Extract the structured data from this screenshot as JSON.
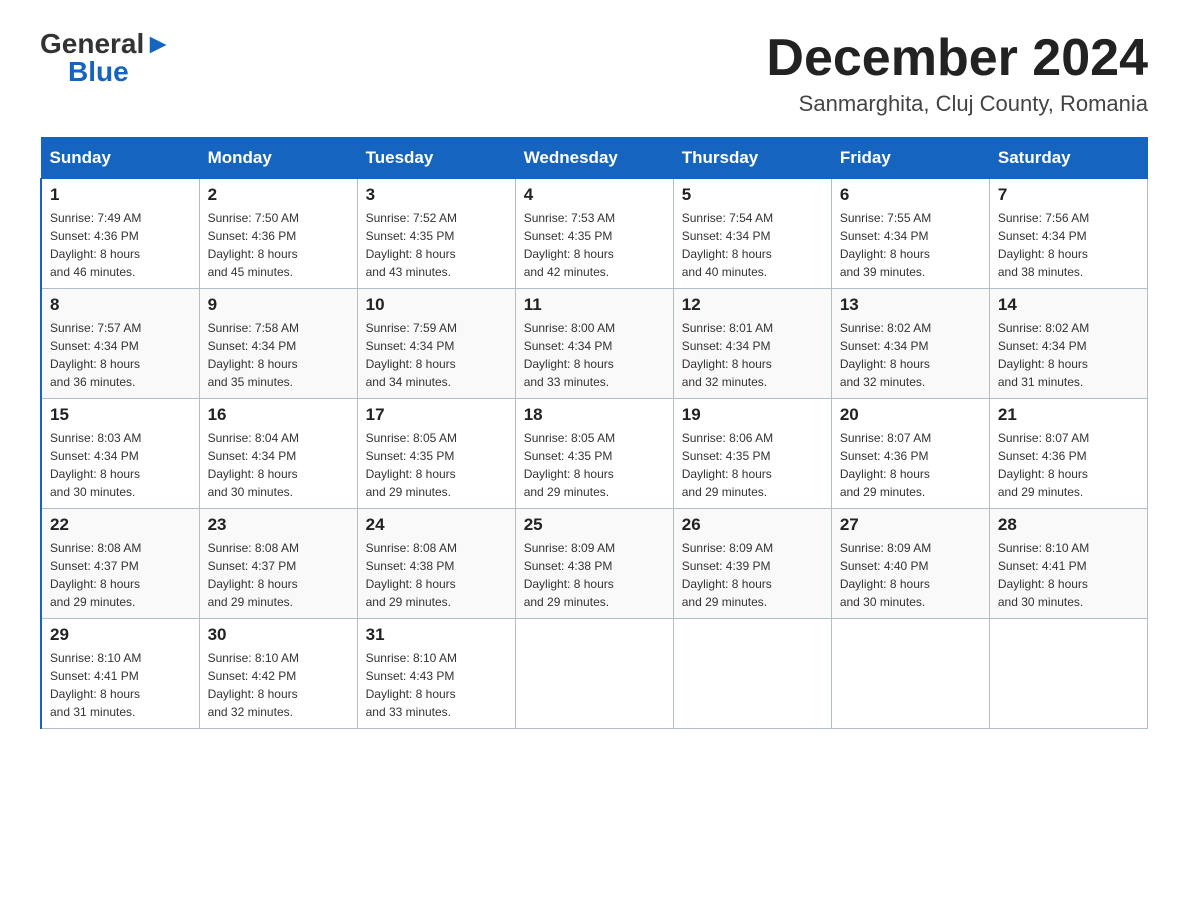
{
  "header": {
    "logo_general": "General",
    "logo_blue": "Blue",
    "month_title": "December 2024",
    "location": "Sanmarghita, Cluj County, Romania"
  },
  "days_of_week": [
    "Sunday",
    "Monday",
    "Tuesday",
    "Wednesday",
    "Thursday",
    "Friday",
    "Saturday"
  ],
  "weeks": [
    [
      {
        "day": "1",
        "sunrise": "7:49 AM",
        "sunset": "4:36 PM",
        "daylight": "8 hours and 46 minutes."
      },
      {
        "day": "2",
        "sunrise": "7:50 AM",
        "sunset": "4:36 PM",
        "daylight": "8 hours and 45 minutes."
      },
      {
        "day": "3",
        "sunrise": "7:52 AM",
        "sunset": "4:35 PM",
        "daylight": "8 hours and 43 minutes."
      },
      {
        "day": "4",
        "sunrise": "7:53 AM",
        "sunset": "4:35 PM",
        "daylight": "8 hours and 42 minutes."
      },
      {
        "day": "5",
        "sunrise": "7:54 AM",
        "sunset": "4:34 PM",
        "daylight": "8 hours and 40 minutes."
      },
      {
        "day": "6",
        "sunrise": "7:55 AM",
        "sunset": "4:34 PM",
        "daylight": "8 hours and 39 minutes."
      },
      {
        "day": "7",
        "sunrise": "7:56 AM",
        "sunset": "4:34 PM",
        "daylight": "8 hours and 38 minutes."
      }
    ],
    [
      {
        "day": "8",
        "sunrise": "7:57 AM",
        "sunset": "4:34 PM",
        "daylight": "8 hours and 36 minutes."
      },
      {
        "day": "9",
        "sunrise": "7:58 AM",
        "sunset": "4:34 PM",
        "daylight": "8 hours and 35 minutes."
      },
      {
        "day": "10",
        "sunrise": "7:59 AM",
        "sunset": "4:34 PM",
        "daylight": "8 hours and 34 minutes."
      },
      {
        "day": "11",
        "sunrise": "8:00 AM",
        "sunset": "4:34 PM",
        "daylight": "8 hours and 33 minutes."
      },
      {
        "day": "12",
        "sunrise": "8:01 AM",
        "sunset": "4:34 PM",
        "daylight": "8 hours and 32 minutes."
      },
      {
        "day": "13",
        "sunrise": "8:02 AM",
        "sunset": "4:34 PM",
        "daylight": "8 hours and 32 minutes."
      },
      {
        "day": "14",
        "sunrise": "8:02 AM",
        "sunset": "4:34 PM",
        "daylight": "8 hours and 31 minutes."
      }
    ],
    [
      {
        "day": "15",
        "sunrise": "8:03 AM",
        "sunset": "4:34 PM",
        "daylight": "8 hours and 30 minutes."
      },
      {
        "day": "16",
        "sunrise": "8:04 AM",
        "sunset": "4:34 PM",
        "daylight": "8 hours and 30 minutes."
      },
      {
        "day": "17",
        "sunrise": "8:05 AM",
        "sunset": "4:35 PM",
        "daylight": "8 hours and 29 minutes."
      },
      {
        "day": "18",
        "sunrise": "8:05 AM",
        "sunset": "4:35 PM",
        "daylight": "8 hours and 29 minutes."
      },
      {
        "day": "19",
        "sunrise": "8:06 AM",
        "sunset": "4:35 PM",
        "daylight": "8 hours and 29 minutes."
      },
      {
        "day": "20",
        "sunrise": "8:07 AM",
        "sunset": "4:36 PM",
        "daylight": "8 hours and 29 minutes."
      },
      {
        "day": "21",
        "sunrise": "8:07 AM",
        "sunset": "4:36 PM",
        "daylight": "8 hours and 29 minutes."
      }
    ],
    [
      {
        "day": "22",
        "sunrise": "8:08 AM",
        "sunset": "4:37 PM",
        "daylight": "8 hours and 29 minutes."
      },
      {
        "day": "23",
        "sunrise": "8:08 AM",
        "sunset": "4:37 PM",
        "daylight": "8 hours and 29 minutes."
      },
      {
        "day": "24",
        "sunrise": "8:08 AM",
        "sunset": "4:38 PM",
        "daylight": "8 hours and 29 minutes."
      },
      {
        "day": "25",
        "sunrise": "8:09 AM",
        "sunset": "4:38 PM",
        "daylight": "8 hours and 29 minutes."
      },
      {
        "day": "26",
        "sunrise": "8:09 AM",
        "sunset": "4:39 PM",
        "daylight": "8 hours and 29 minutes."
      },
      {
        "day": "27",
        "sunrise": "8:09 AM",
        "sunset": "4:40 PM",
        "daylight": "8 hours and 30 minutes."
      },
      {
        "day": "28",
        "sunrise": "8:10 AM",
        "sunset": "4:41 PM",
        "daylight": "8 hours and 30 minutes."
      }
    ],
    [
      {
        "day": "29",
        "sunrise": "8:10 AM",
        "sunset": "4:41 PM",
        "daylight": "8 hours and 31 minutes."
      },
      {
        "day": "30",
        "sunrise": "8:10 AM",
        "sunset": "4:42 PM",
        "daylight": "8 hours and 32 minutes."
      },
      {
        "day": "31",
        "sunrise": "8:10 AM",
        "sunset": "4:43 PM",
        "daylight": "8 hours and 33 minutes."
      },
      null,
      null,
      null,
      null
    ]
  ],
  "labels": {
    "sunrise": "Sunrise:",
    "sunset": "Sunset:",
    "daylight": "Daylight:"
  }
}
